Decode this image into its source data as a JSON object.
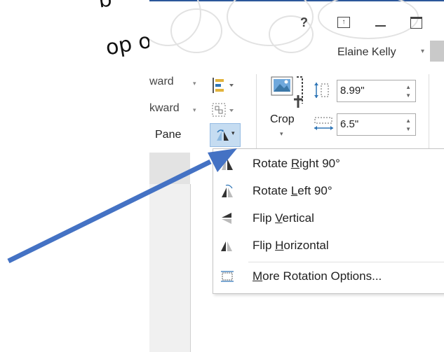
{
  "annotations": {
    "top": "b",
    "second": "op of object"
  },
  "titlebar": {
    "help": "?",
    "user": "Elaine Kelly",
    "user_caret": "▾"
  },
  "ribbon": {
    "bring_forward": "ward",
    "send_backward": "kward",
    "selection_pane": "Pane",
    "crop_label": "Crop",
    "height_value": "8.99\"",
    "width_value": "6.5\""
  },
  "menu": {
    "items": [
      {
        "before": "Rotate ",
        "key": "R",
        "after": "ight 90°",
        "icon": "rotate-right-icon"
      },
      {
        "before": "Rotate ",
        "key": "L",
        "after": "eft 90°",
        "icon": "rotate-left-icon"
      },
      {
        "before": "Flip ",
        "key": "V",
        "after": "ertical",
        "icon": "flip-vertical-icon"
      },
      {
        "before": "Flip ",
        "key": "H",
        "after": "orizontal",
        "icon": "flip-horizontal-icon"
      },
      {
        "before": "",
        "key": "M",
        "after": "ore Rotation Options...",
        "icon": "more-rotation-icon"
      }
    ]
  },
  "colors": {
    "arrow": "#4472c4",
    "accent": "#2b579a",
    "highlight": "#c5dcf1"
  }
}
